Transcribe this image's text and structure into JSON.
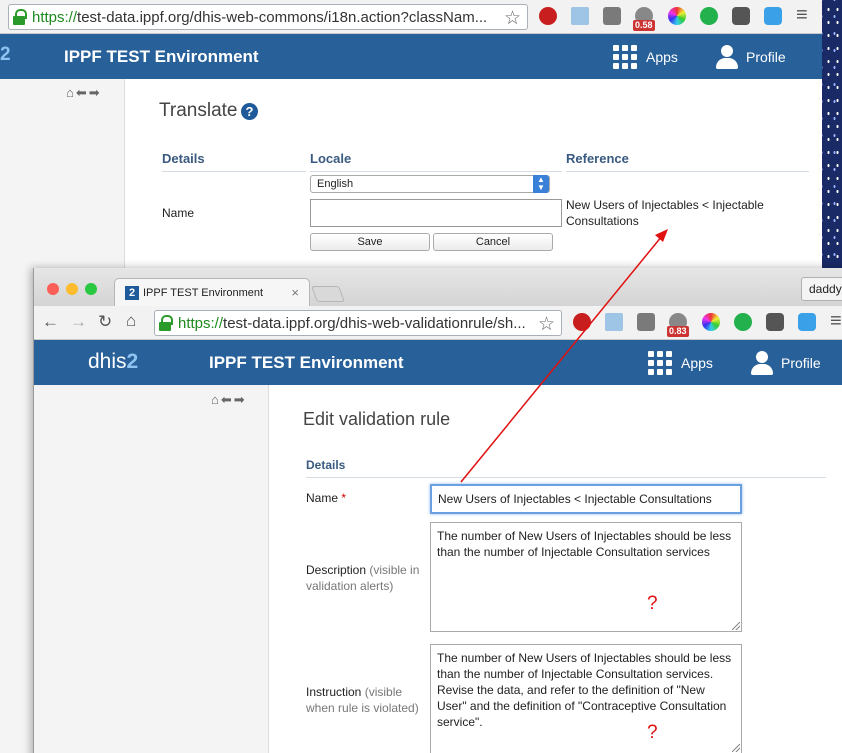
{
  "back_window": {
    "url_https": "https://",
    "url_rest": "test-data.ippf.org/dhis-web-commons/i18n.action?classNam...",
    "ext_badge_1": "0.58",
    "logo_num": "2",
    "app_title": "IPPF TEST Environment",
    "apps_label": "Apps",
    "profile_label": "Profile",
    "page_title": "Translate",
    "help_glyph": "?",
    "table": {
      "col_details": "Details",
      "col_locale": "Locale",
      "col_reference": "Reference"
    },
    "locale_value": "English",
    "name_label": "Name",
    "name_value": "",
    "save_label": "Save",
    "cancel_label": "Cancel",
    "reference_text": "New Users of Injectables < Injectable Consultations"
  },
  "front_window": {
    "tab_favicon": "2",
    "tab_title": "IPPF TEST Environment",
    "tab_close": "×",
    "profile_chip": "daddy",
    "url_https": "https://",
    "url_rest": "test-data.ippf.org/dhis-web-validationrule/sh...",
    "ext_badge_1": "0.83",
    "logo_dhis": "dhis",
    "logo_2": "2",
    "app_title": "IPPF TEST Environment",
    "apps_label": "Apps",
    "profile_label": "Profile",
    "page_title": "Edit validation rule",
    "section_details": "Details",
    "name_label": "Name",
    "required_mark": "*",
    "name_value": "New Users of Injectables < Injectable Consultations",
    "description_label": "Description",
    "description_hint": "(visible in validation alerts)",
    "description_value": "The number of New Users of Injectables should be less than the number of Injectable Consultation services",
    "instruction_label": "Instruction",
    "instruction_hint": "(visible when rule is violated)",
    "instruction_value": "The number of New Users of Injectables should be less than the number of Injectable Consultation services. Revise the data, and refer to the definition of \"New User\" and the definition of \"Contraceptive Consultation service\".",
    "annotation_mark": "?"
  },
  "colors": {
    "header_blue": "#286099",
    "annotation_red": "#e01010",
    "https_green": "#1f8a1f"
  }
}
